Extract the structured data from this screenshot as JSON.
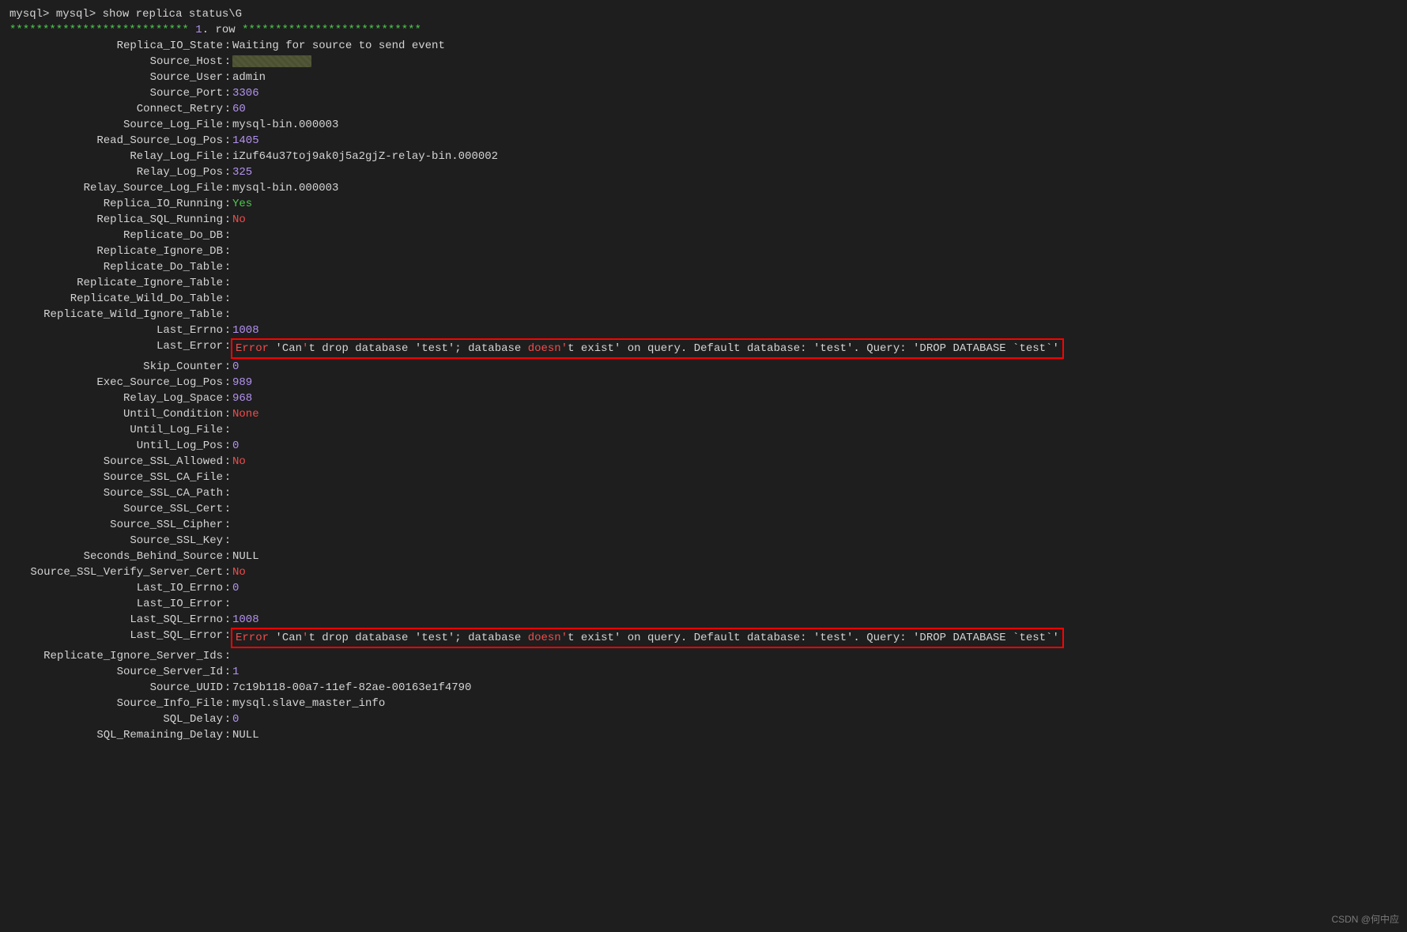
{
  "prompt1": "mysql>",
  "prompt2": "mysql>",
  "command": "show replica status\\G",
  "row_stars": "***************************",
  "row_num": "1",
  "row_word": "row",
  "fields": [
    {
      "k": "Replica_IO_State",
      "v": "Waiting for source to send event",
      "t": "str"
    },
    {
      "k": "Source_Host",
      "v": "REDACTED",
      "t": "redacted"
    },
    {
      "k": "Source_User",
      "v": "admin",
      "t": "str"
    },
    {
      "k": "Source_Port",
      "v": "3306",
      "t": "num"
    },
    {
      "k": "Connect_Retry",
      "v": "60",
      "t": "num"
    },
    {
      "k": "Source_Log_File",
      "v": "mysql-bin.000003",
      "t": "str"
    },
    {
      "k": "Read_Source_Log_Pos",
      "v": "1405",
      "t": "num"
    },
    {
      "k": "Relay_Log_File",
      "v": "iZuf64u37toj9ak0j5a2gjZ-relay-bin.000002",
      "t": "str"
    },
    {
      "k": "Relay_Log_Pos",
      "v": "325",
      "t": "num"
    },
    {
      "k": "Relay_Source_Log_File",
      "v": "mysql-bin.000003",
      "t": "str"
    },
    {
      "k": "Replica_IO_Running",
      "v": "Yes",
      "t": "yes"
    },
    {
      "k": "Replica_SQL_Running",
      "v": "No",
      "t": "red"
    },
    {
      "k": "Replicate_Do_DB",
      "v": "",
      "t": "str"
    },
    {
      "k": "Replicate_Ignore_DB",
      "v": "",
      "t": "str"
    },
    {
      "k": "Replicate_Do_Table",
      "v": "",
      "t": "str"
    },
    {
      "k": "Replicate_Ignore_Table",
      "v": "",
      "t": "str"
    },
    {
      "k": "Replicate_Wild_Do_Table",
      "v": "",
      "t": "str"
    },
    {
      "k": "Replicate_Wild_Ignore_Table",
      "v": "",
      "t": "str"
    },
    {
      "k": "Last_Errno",
      "v": "1008",
      "t": "num"
    },
    {
      "k": "Last_Error",
      "v": "ERRBOX",
      "t": "errbox"
    },
    {
      "k": "Skip_Counter",
      "v": "0",
      "t": "num"
    },
    {
      "k": "Exec_Source_Log_Pos",
      "v": "989",
      "t": "num"
    },
    {
      "k": "Relay_Log_Space",
      "v": "968",
      "t": "num"
    },
    {
      "k": "Until_Condition",
      "v": "None",
      "t": "none"
    },
    {
      "k": "Until_Log_File",
      "v": "",
      "t": "str"
    },
    {
      "k": "Until_Log_Pos",
      "v": "0",
      "t": "num"
    },
    {
      "k": "Source_SSL_Allowed",
      "v": "No",
      "t": "red"
    },
    {
      "k": "Source_SSL_CA_File",
      "v": "",
      "t": "str"
    },
    {
      "k": "Source_SSL_CA_Path",
      "v": "",
      "t": "str"
    },
    {
      "k": "Source_SSL_Cert",
      "v": "",
      "t": "str"
    },
    {
      "k": "Source_SSL_Cipher",
      "v": "",
      "t": "str"
    },
    {
      "k": "Source_SSL_Key",
      "v": "",
      "t": "str"
    },
    {
      "k": "Seconds_Behind_Source",
      "v": "NULL",
      "t": "str"
    },
    {
      "k": "Source_SSL_Verify_Server_Cert",
      "v": "No",
      "t": "red"
    },
    {
      "k": "Last_IO_Errno",
      "v": "0",
      "t": "num"
    },
    {
      "k": "Last_IO_Error",
      "v": "",
      "t": "str"
    },
    {
      "k": "Last_SQL_Errno",
      "v": "1008",
      "t": "num"
    },
    {
      "k": "Last_SQL_Error",
      "v": "ERRBOX",
      "t": "errbox"
    },
    {
      "k": "Replicate_Ignore_Server_Ids",
      "v": "",
      "t": "str"
    },
    {
      "k": "Source_Server_Id",
      "v": "1",
      "t": "num"
    },
    {
      "k": "Source_UUID",
      "v": "7c19b118-00a7-11ef-82ae-00163e1f4790",
      "t": "str"
    },
    {
      "k": "Source_Info_File",
      "v": "mysql.slave_master_info",
      "t": "str"
    },
    {
      "k": "SQL_Delay",
      "v": "0",
      "t": "num"
    },
    {
      "k": "SQL_Remaining_Delay",
      "v": "NULL",
      "t": "str"
    }
  ],
  "error_parts": {
    "err": "Error",
    "p1": " 'Can",
    "q1": "'",
    "p2": "t drop database ",
    "q2": "'test'",
    "p3": "; database ",
    "doesn": "doesn",
    "q3": "'",
    "p4": "t exist",
    "q4": "'",
    "p5": " on query. Default database: ",
    "q5": "'test'",
    "p6": ". Query: ",
    "q6": "'DROP DATABASE `test`'"
  },
  "watermark": "CSDN @何中应"
}
